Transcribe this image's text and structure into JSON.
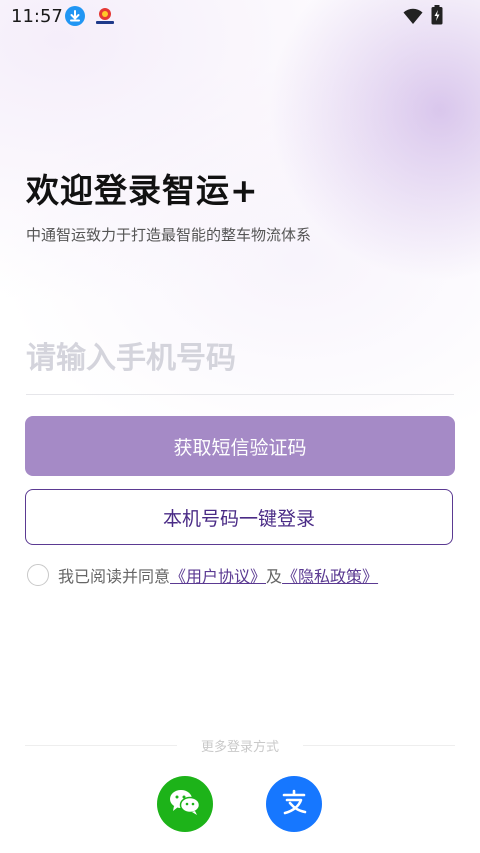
{
  "status_bar": {
    "time": "11:57",
    "icons": [
      "download-icon",
      "app-badge-icon",
      "wifi-icon",
      "battery-charging-icon"
    ]
  },
  "header": {
    "title": "欢迎登录智运+",
    "subtitle": "中通智运致力于打造最智能的整车物流体系"
  },
  "phone_input": {
    "value": "",
    "placeholder": "请输入手机号码"
  },
  "buttons": {
    "sms_code": "获取短信验证码",
    "one_key_login": "本机号码一键登录"
  },
  "agreement": {
    "checked": false,
    "prefix": "我已阅读并同意",
    "user_agreement": "《用户协议》",
    "and": "及",
    "privacy_policy": "《隐私政策》"
  },
  "more_login": {
    "label": "更多登录方式",
    "methods": [
      "wechat-icon",
      "alipay-icon"
    ]
  },
  "colors": {
    "primary_button": "#a58ac6",
    "outline_button": "#5b3a92",
    "wechat": "#1db319",
    "alipay": "#1677ff"
  }
}
